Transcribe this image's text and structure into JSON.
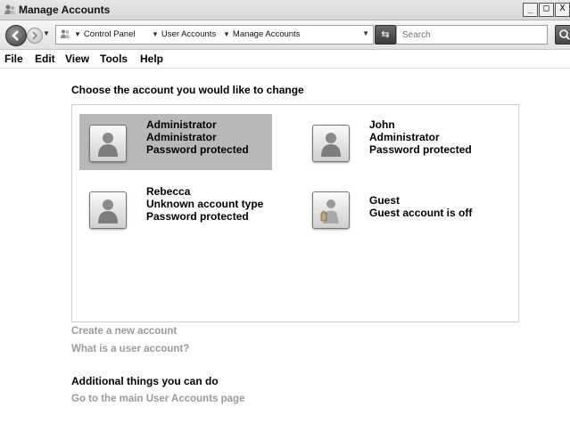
{
  "window": {
    "title": "Manage Accounts",
    "buttons": [
      "_",
      "□",
      "X"
    ]
  },
  "address_bar": {
    "breadcrumbs": [
      "Control Panel",
      "User Accounts",
      "Manage Accounts"
    ],
    "search_placeholder": "Search"
  },
  "menu": [
    "File",
    "Edit",
    "View",
    "Tools",
    "Help"
  ],
  "main": {
    "heading": "Choose the account you would like to change",
    "accounts": [
      {
        "name": "Administrator",
        "type": "Administrator",
        "status": "Password protected",
        "avatar": "user-silhouette-icon",
        "selected": true
      },
      {
        "name": "John",
        "type": "Administrator",
        "status": "Password protected",
        "avatar": "user-silhouette-icon",
        "selected": false
      },
      {
        "name": "Rebecca",
        "type": "Unknown account type",
        "status": "Password protected",
        "avatar": "user-silhouette-icon",
        "selected": false
      },
      {
        "name": "Guest",
        "type": "Guest account is off",
        "status": "",
        "avatar": "guest-user-icon",
        "selected": false
      }
    ],
    "links": {
      "create": "Create a new account",
      "what_is": "What is a user account?"
    },
    "additional": {
      "heading": "Additional things you can do",
      "main_page_link": "Go to the main User Accounts page"
    }
  },
  "colors": {
    "selected_bg": "#b8b8b8",
    "link_color": "#9a9a9a"
  }
}
